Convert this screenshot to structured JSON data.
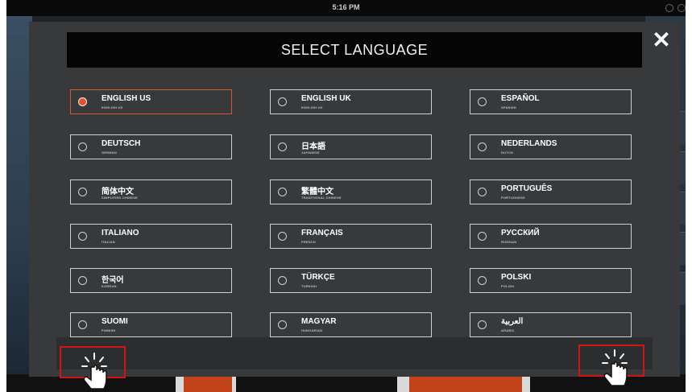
{
  "status_bar": {
    "time": "5:16 PM"
  },
  "dialog": {
    "title": "SELECT LANGUAGE",
    "close_label": "✕",
    "languages": [
      {
        "name": "ENGLISH US",
        "sub": "ENGLISH US",
        "selected": true
      },
      {
        "name": "ENGLISH UK",
        "sub": "ENGLISH UK",
        "selected": false
      },
      {
        "name": "ESPAÑOL",
        "sub": "SPANISH",
        "selected": false
      },
      {
        "name": "DEUTSCH",
        "sub": "GERMAN",
        "selected": false
      },
      {
        "name": "日本語",
        "sub": "JAPANESE",
        "selected": false
      },
      {
        "name": "NEDERLANDS",
        "sub": "DUTCH",
        "selected": false
      },
      {
        "name": "简体中文",
        "sub": "SIMPLIFIED CHINESE",
        "selected": false
      },
      {
        "name": "繁體中文",
        "sub": "TRADITIONAL CHINESE",
        "selected": false
      },
      {
        "name": "PORTUGUÊS",
        "sub": "PORTUGUESE",
        "selected": false
      },
      {
        "name": "ITALIANO",
        "sub": "ITALIAN",
        "selected": false
      },
      {
        "name": "FRANÇAIS",
        "sub": "FRENCH",
        "selected": false
      },
      {
        "name": "РУССКИЙ",
        "sub": "RUSSIAN",
        "selected": false
      },
      {
        "name": "한국어",
        "sub": "KOREAN",
        "selected": false
      },
      {
        "name": "TÜRKÇE",
        "sub": "TURKISH",
        "selected": false
      },
      {
        "name": "POLSKI",
        "sub": "POLISH",
        "selected": false
      },
      {
        "name": "SUOMI",
        "sub": "FINNISH",
        "selected": false
      },
      {
        "name": "MAGYAR",
        "sub": "HUNGARIAN",
        "selected": false
      },
      {
        "name": "العربية",
        "sub": "ARABIC",
        "selected": false
      }
    ]
  },
  "tap_targets": [
    {
      "side": "left",
      "icon": "hand-tap-icon",
      "highlight": "#d21414"
    },
    {
      "side": "right",
      "icon": "hand-tap-icon",
      "highlight": "#d21414"
    }
  ],
  "colors": {
    "accent": "#e8522a",
    "modal_bg": "#37393b",
    "title_bg": "#050505"
  }
}
